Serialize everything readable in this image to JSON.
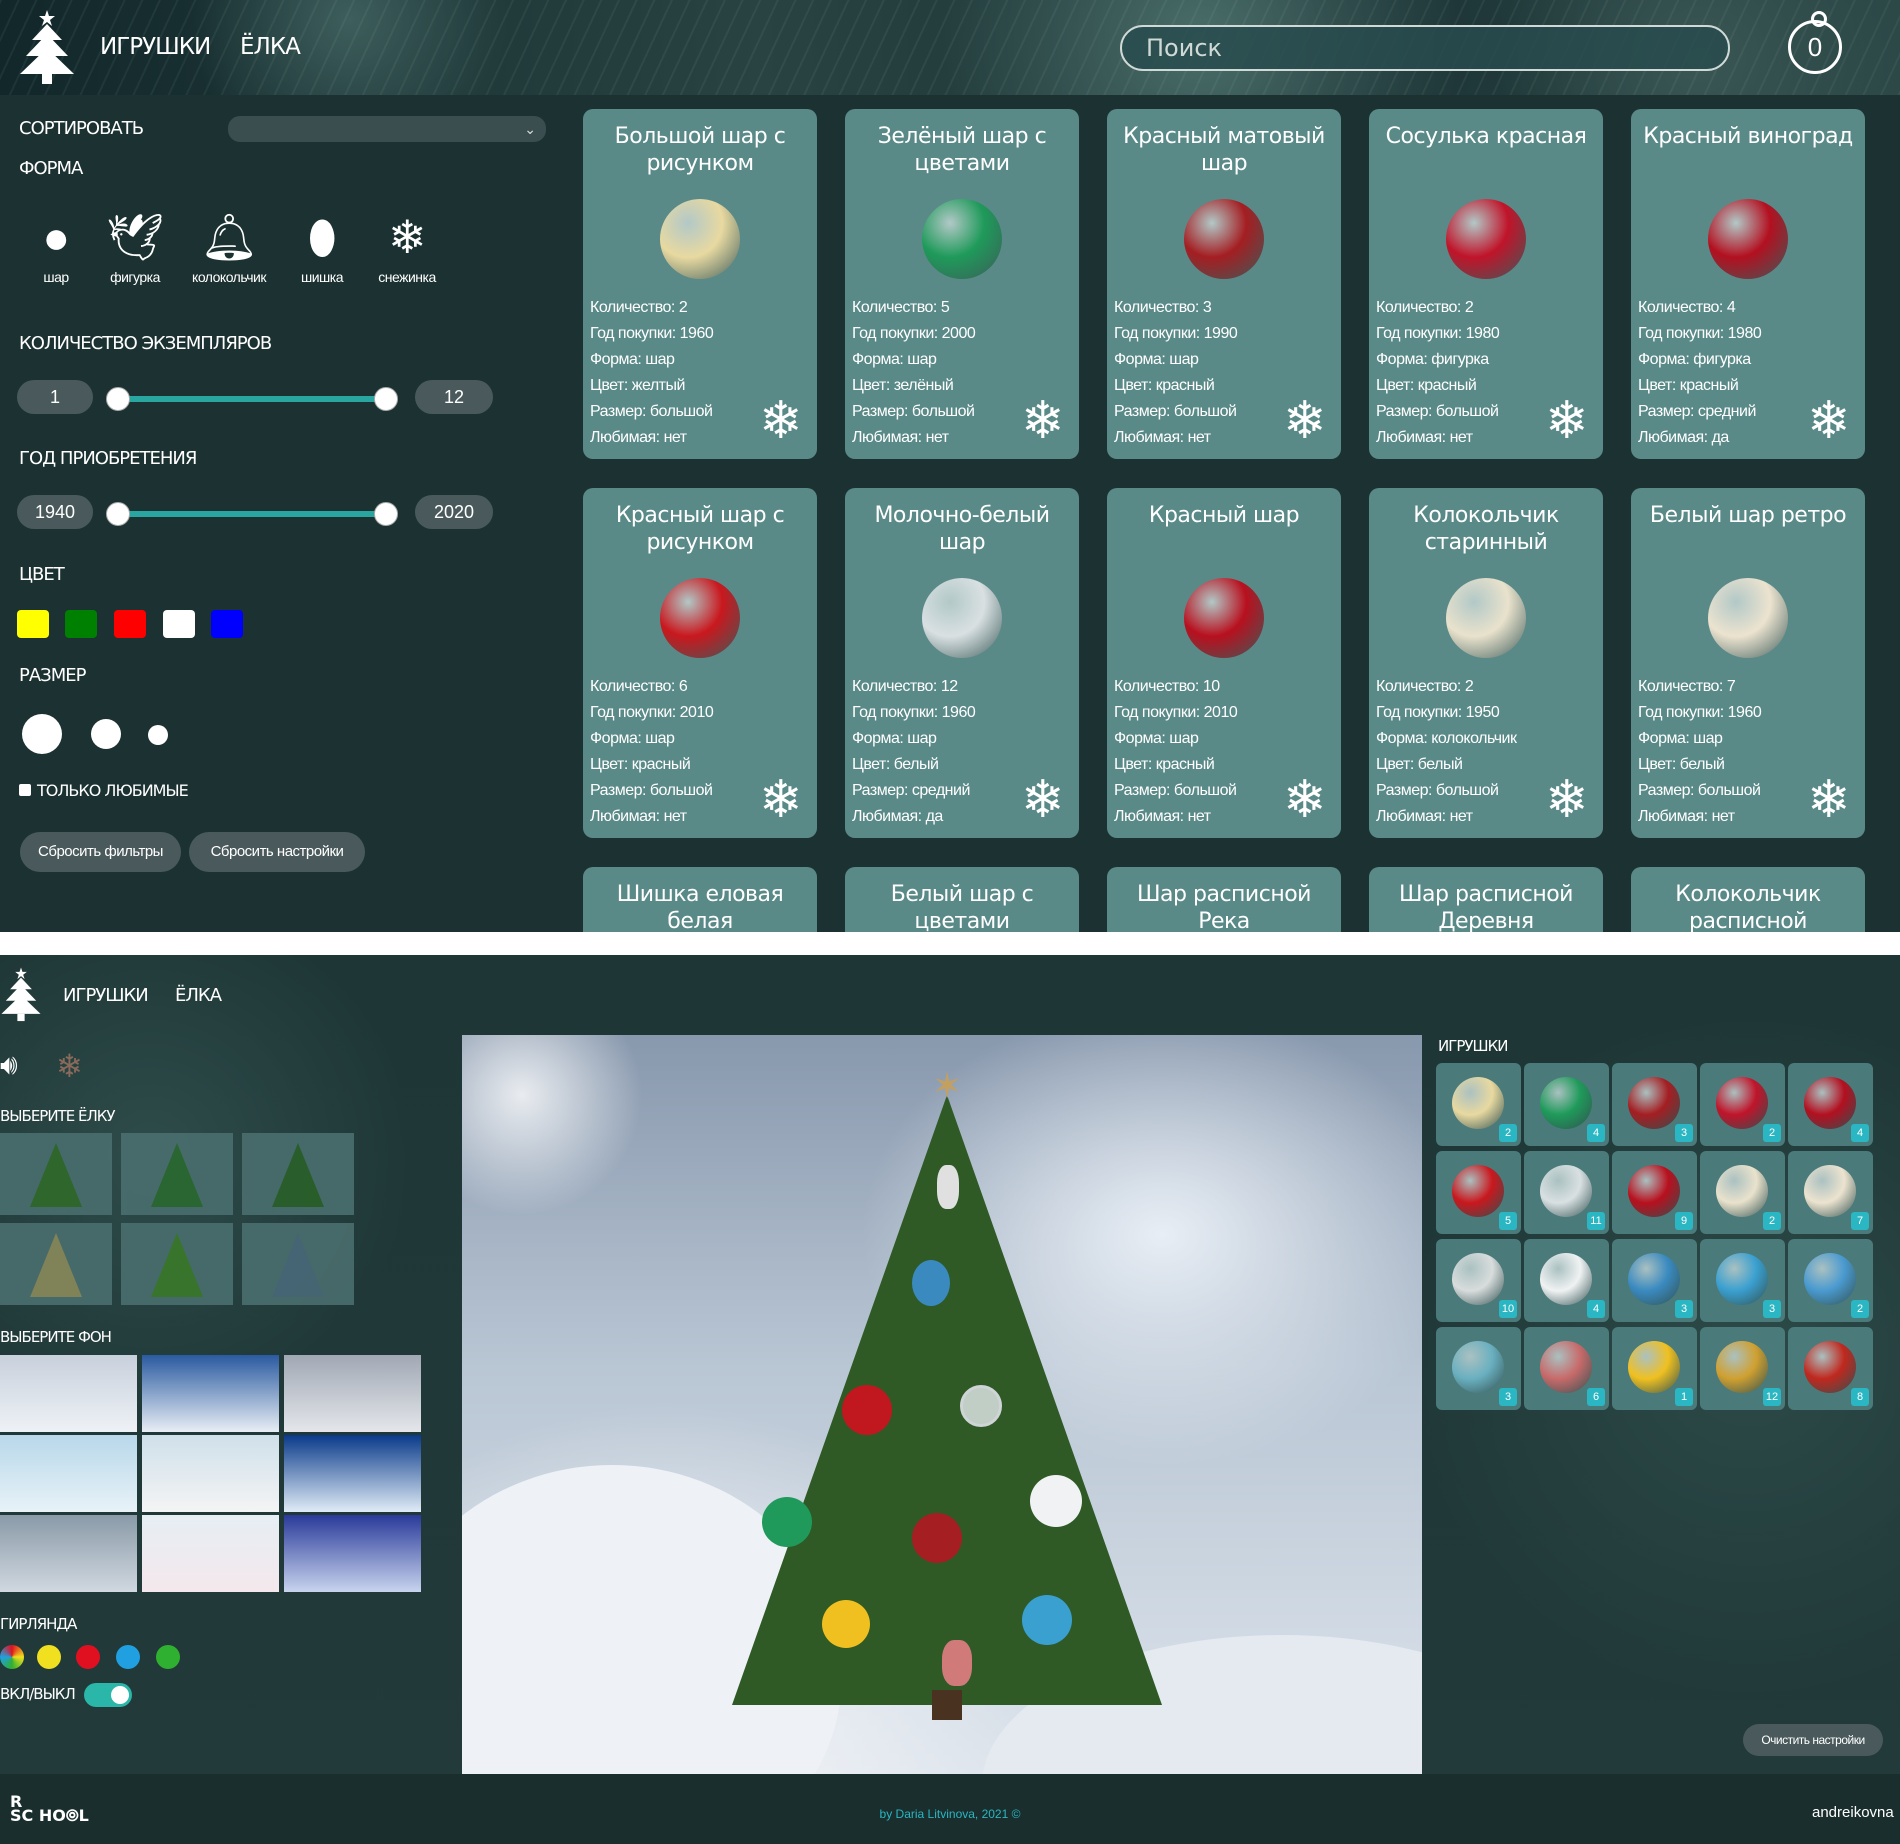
{
  "shot1": {
    "nav": {
      "toys": "ИГРУШКИ",
      "tree": "ЁЛКА"
    },
    "search": {
      "placeholder": "Поиск"
    },
    "cart_count": "0",
    "filters": {
      "sort_label": "СОРТИРОВАТЬ",
      "shape_label": "ФОРМА",
      "shapes": [
        {
          "name": "шар",
          "icon": "ball-icon"
        },
        {
          "name": "фигурка",
          "icon": "bird-icon"
        },
        {
          "name": "колокольчик",
          "icon": "bell-icon"
        },
        {
          "name": "шишка",
          "icon": "cone-icon"
        },
        {
          "name": "снежинка",
          "icon": "snowflake-icon"
        }
      ],
      "count_label": "КОЛИЧЕСТВО ЭКЗЕМПЛЯРОВ",
      "count_min": "1",
      "count_max": "12",
      "year_label": "ГОД ПРИОБРЕТЕНИЯ",
      "year_min": "1940",
      "year_max": "2020",
      "color_label": "ЦВЕТ",
      "colors": [
        "#ffff00",
        "#008000",
        "#ff0000",
        "#ffffff",
        "#0000ff"
      ],
      "size_label": "РАЗМЕР",
      "favorites_label": "ТОЛЬКО ЛЮБИМЫЕ",
      "reset_filters": "Сбросить фильтры",
      "reset_settings": "Сбросить настройки"
    },
    "fields": {
      "count": "Количество: ",
      "year": "Год покупки: ",
      "shape": "Форма: ",
      "color": "Цвет: ",
      "size": "Размер: ",
      "fav": "Любимая: "
    },
    "cards": [
      {
        "title": "Большой шар с рисунком",
        "count": "2",
        "year": "1960",
        "shape": "шар",
        "color": "желтый",
        "size": "большой",
        "fav": "нет",
        "tone": "#e8d9a0"
      },
      {
        "title": "Зелёный шар с цветами",
        "count": "5",
        "year": "2000",
        "shape": "шар",
        "color": "зелёный",
        "size": "большой",
        "fav": "нет",
        "tone": "#1f9a5a"
      },
      {
        "title": "Красный матовый шар",
        "count": "3",
        "year": "1990",
        "shape": "шар",
        "color": "красный",
        "size": "большой",
        "fav": "нет",
        "tone": "#a41e22"
      },
      {
        "title": "Сосулька красная",
        "count": "2",
        "year": "1980",
        "shape": "фигурка",
        "color": "красный",
        "size": "большой",
        "fav": "нет",
        "tone": "#c0142a"
      },
      {
        "title": "Красный виноград",
        "count": "4",
        "year": "1980",
        "shape": "фигурка",
        "color": "красный",
        "size": "средний",
        "fav": "да",
        "tone": "#b31020"
      },
      {
        "title": "Красный шар с рисунком",
        "count": "6",
        "year": "2010",
        "shape": "шар",
        "color": "красный",
        "size": "большой",
        "fav": "нет",
        "tone": "#c9181e"
      },
      {
        "title": "Молочно-белый шар",
        "count": "12",
        "year": "1960",
        "shape": "шар",
        "color": "белый",
        "size": "средний",
        "fav": "да",
        "tone": "#d9e0e2"
      },
      {
        "title": "Красный шар",
        "count": "10",
        "year": "2010",
        "shape": "шар",
        "color": "красный",
        "size": "большой",
        "fav": "нет",
        "tone": "#b8101e"
      },
      {
        "title": "Колокольчик старинный",
        "count": "2",
        "year": "1950",
        "shape": "колокольчик",
        "color": "белый",
        "size": "большой",
        "fav": "нет",
        "tone": "#e9e2cc"
      },
      {
        "title": "Белый шар ретро",
        "count": "7",
        "year": "1960",
        "shape": "шар",
        "color": "белый",
        "size": "большой",
        "fav": "нет",
        "tone": "#ece3cf"
      }
    ],
    "partial_cards": [
      "Шишка еловая белая",
      "Белый шар с цветами",
      "Шар расписной Река",
      "Шар расписной Деревня",
      "Колокольчик расписной"
    ]
  },
  "shot2": {
    "nav": {
      "toys": "ИГРУШКИ",
      "tree": "ЁЛКА"
    },
    "choose_tree": "ВЫБЕРИТЕ ЁЛКУ",
    "choose_bg": "ВЫБЕРИТЕ ФОН",
    "garland": "ГИРЛЯНДА",
    "onoff": "ВКЛ/ВЫКЛ",
    "garland_colors": [
      "#e8c020",
      "#f0e020",
      "#e01020",
      "#20a0e0",
      "#30b030"
    ],
    "toys_title": "ИГРУШКИ",
    "slots": [
      {
        "n": "2",
        "c": "#e8d9a0"
      },
      {
        "n": "4",
        "c": "#1f9a5a"
      },
      {
        "n": "3",
        "c": "#a41e22"
      },
      {
        "n": "2",
        "c": "#c0142a"
      },
      {
        "n": "4",
        "c": "#b31020"
      },
      {
        "n": "5",
        "c": "#c9181e"
      },
      {
        "n": "11",
        "c": "#d9e0e2"
      },
      {
        "n": "9",
        "c": "#b8101e"
      },
      {
        "n": "2",
        "c": "#e9e2cc"
      },
      {
        "n": "7",
        "c": "#ece3cf"
      },
      {
        "n": "10",
        "c": "#d8dcdc"
      },
      {
        "n": "4",
        "c": "#f0f2f3"
      },
      {
        "n": "3",
        "c": "#3a8ac0"
      },
      {
        "n": "3",
        "c": "#3aa0d0"
      },
      {
        "n": "2",
        "c": "#4a9ad0"
      },
      {
        "n": "3",
        "c": "#6ab0c0"
      },
      {
        "n": "6",
        "c": "#c86a6a"
      },
      {
        "n": "1",
        "c": "#f0c020"
      },
      {
        "n": "12",
        "c": "#d0a030"
      },
      {
        "n": "8",
        "c": "#c0281e"
      }
    ],
    "clear_settings": "Очистить настройки",
    "footer_credit": "by Daria Litvinova, 2021 ©",
    "footer_user": "andreikovna",
    "school_logo": "RS SCHOOL"
  }
}
